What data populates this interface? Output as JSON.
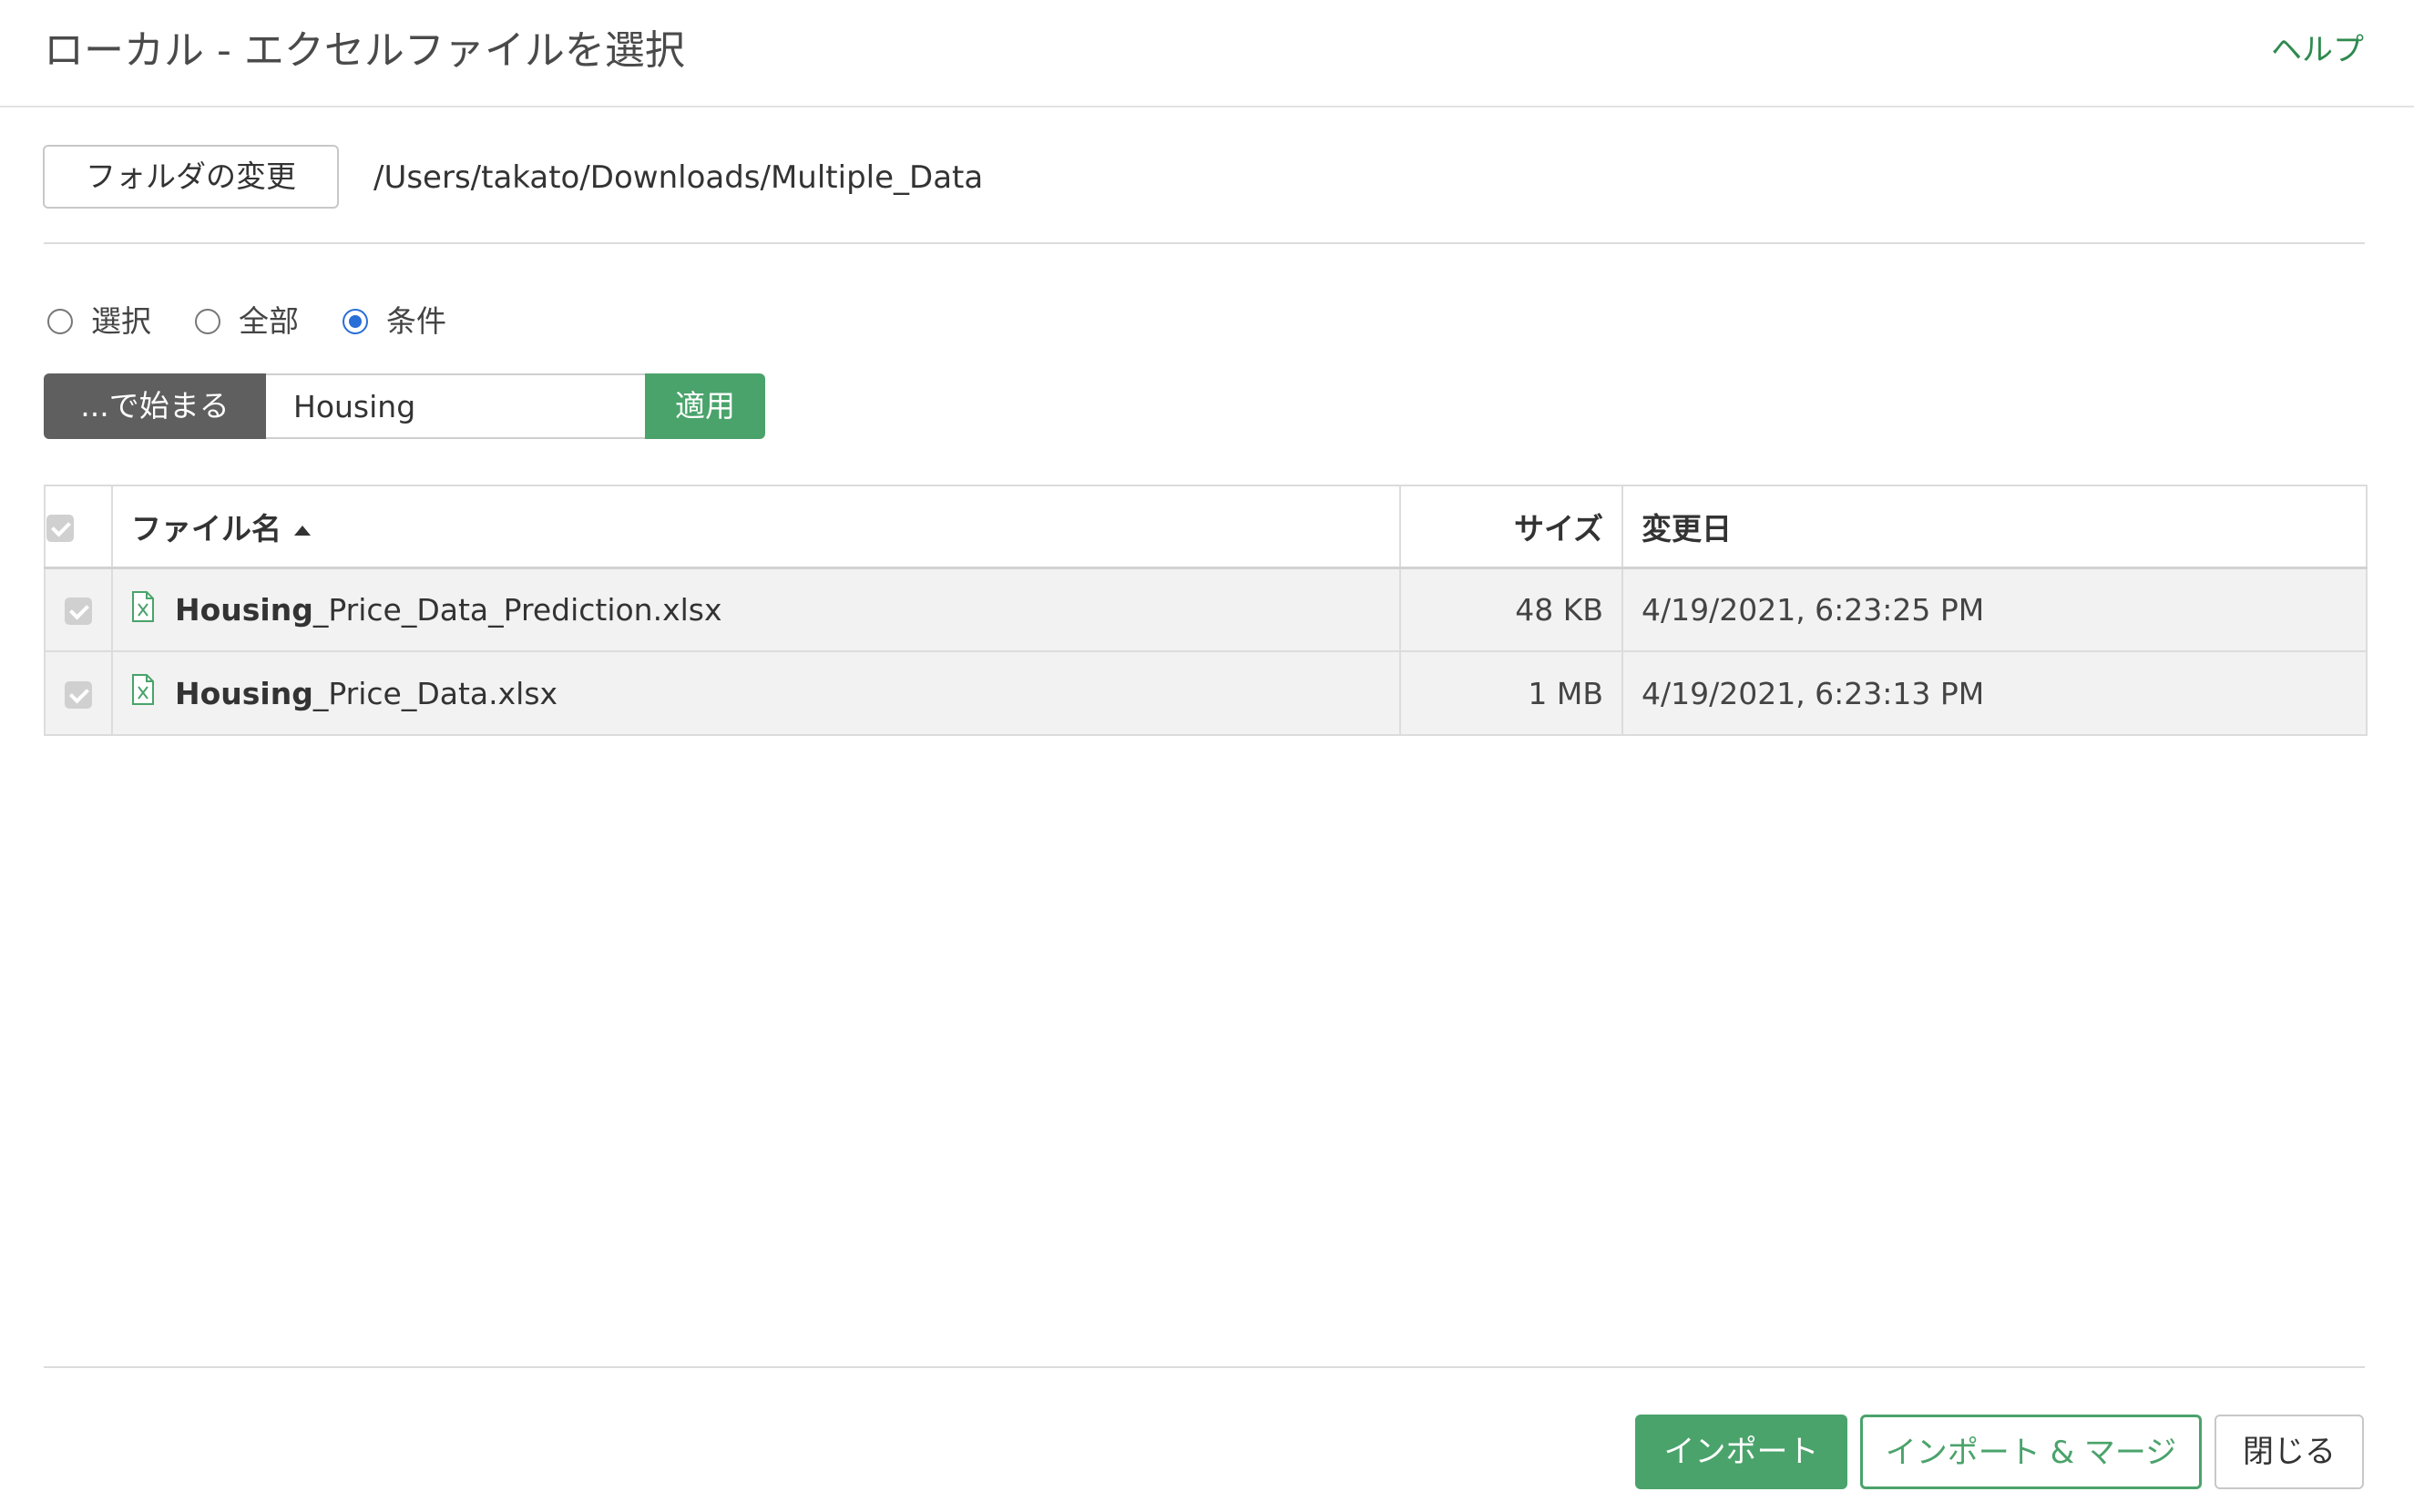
{
  "dialog": {
    "title": "ローカル - エクセルファイルを選択",
    "help_label": "ヘルプ"
  },
  "folder": {
    "change_button_label": "フォルダの変更",
    "path": "/Users/takato/Downloads/Multiple_Data"
  },
  "selection_mode": {
    "options": [
      {
        "label": "選択",
        "checked": false
      },
      {
        "label": "全部",
        "checked": false
      },
      {
        "label": "条件",
        "checked": true
      }
    ]
  },
  "filter": {
    "mode_label": "...で始まる",
    "value": "Housing",
    "apply_label": "適用"
  },
  "table": {
    "columns": {
      "name": "ファイル名",
      "size": "サイズ",
      "modified": "変更日"
    },
    "sort": {
      "column": "name",
      "direction": "ascending"
    },
    "header_checked": true,
    "rows": [
      {
        "checked": true,
        "icon": "excel-file-icon",
        "name_match": "Housing",
        "name_rest": "_Price_Data_Prediction.xlsx",
        "size": "48 KB",
        "modified": "4/19/2021, 6:23:25 PM"
      },
      {
        "checked": true,
        "icon": "excel-file-icon",
        "name_match": "Housing",
        "name_rest": "_Price_Data.xlsx",
        "size": "1 MB",
        "modified": "4/19/2021, 6:23:13 PM"
      }
    ]
  },
  "footer": {
    "import_label": "インポート",
    "import_merge_label": "インポート & マージ",
    "close_label": "閉じる"
  },
  "colors": {
    "accent_green": "#4aa36b",
    "help_green": "#2f8a4e",
    "radio_blue": "#2a6ed8",
    "filter_mode_bg": "#5f5f5f"
  }
}
